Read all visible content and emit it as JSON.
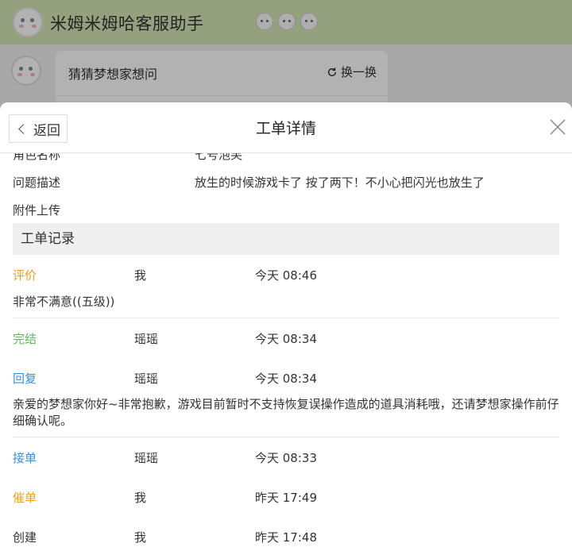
{
  "app": {
    "title": "米姆米姆哈客服助手",
    "chat_card_title": "猜猜梦想家想问",
    "refresh_label": "换一换"
  },
  "modal": {
    "back_label": "返回",
    "title": "工单详情"
  },
  "info": {
    "role_label": "角色名称",
    "role_value": "七号泡芙",
    "desc_label": "问题描述",
    "desc_value": "放生的时候游戏卡了 按了两下！不小心把闪光也放生了",
    "attach_label": "附件上传"
  },
  "records_title": "工单记录",
  "records": [
    {
      "action": "评价",
      "user": "我",
      "time": "今天 08:46",
      "color": "#f0a020",
      "text": "非常不满意((五级))"
    },
    {
      "action": "完结",
      "user": "瑶瑶",
      "time": "今天 08:34",
      "color": "#5cb85c",
      "text": ""
    },
    {
      "action": "回复",
      "user": "瑶瑶",
      "time": "今天 08:34",
      "color": "#3b8de0",
      "text": "亲爱的梦想家你好~非常抱歉，游戏目前暂时不支持恢复误操作造成的道具消耗哦，还请梦想家操作前仔细确认呢。"
    },
    {
      "action": "接单",
      "user": "瑶瑶",
      "time": "今天 08:33",
      "color": "#3b8de0",
      "text": ""
    },
    {
      "action": "催单",
      "user": "我",
      "time": "昨天 17:49",
      "color": "#f0a020",
      "text": ""
    },
    {
      "action": "创建",
      "user": "我",
      "time": "昨天 17:48",
      "color": "#333333",
      "text": ""
    }
  ],
  "colors": {
    "header_bg": "#d4e6b5",
    "orange": "#f0a020",
    "green": "#5cb85c",
    "blue": "#3b8de0"
  },
  "icons": [
    "avatar",
    "bear-emoji-icon",
    "refresh-icon",
    "chevron-left-icon",
    "close-icon"
  ]
}
